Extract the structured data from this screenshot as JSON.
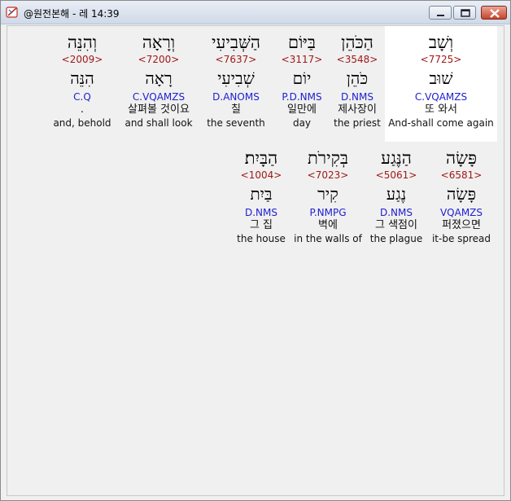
{
  "window": {
    "title": "@원전본해 - 레 14:39",
    "buttons": {
      "minimize": "minimize",
      "maximize": "maximize",
      "close": "close"
    }
  },
  "rows": [
    {
      "words": [
        {
          "hebrew": "וְשָׁב",
          "strong": "<7725>",
          "lemma": "שׁוּב",
          "morph": "C.VQAMZS",
          "korean": "또 와서",
          "english": "And-shall come again",
          "highlighted": true
        },
        {
          "hebrew": "הַכֹּהֵן",
          "strong": "<3548>",
          "lemma": "כֹּהֵן",
          "morph": "D.NMS",
          "korean": "제사장이",
          "english": "the priest"
        },
        {
          "hebrew": "בַּיּוֹם",
          "strong": "<3117>",
          "lemma": "יוֹם",
          "morph": "P.D.NMS",
          "korean": "일만에",
          "english": "day"
        },
        {
          "hebrew": "הַשְּׁבִיעִי",
          "strong": "<7637>",
          "lemma": "שְׁבִיעִי",
          "morph": "D.ANOMS",
          "korean": "칠",
          "english": "the seventh"
        },
        {
          "hebrew": "וְרָאָה",
          "strong": "<7200>",
          "lemma": "רָאָה",
          "morph": "C.VQAMZS",
          "korean": "살펴볼 것이요",
          "english": "and shall look"
        },
        {
          "hebrew": "וְהִנֵּה",
          "strong": "<2009>",
          "lemma": "הִנֵּה",
          "morph": "C.Q",
          "korean": ".",
          "english": "and, behold"
        }
      ]
    },
    {
      "words": [
        {
          "hebrew": "פָּשָׂה",
          "strong": "<6581>",
          "lemma": "פָּשָׂה",
          "morph": "VQAMZS",
          "korean": "퍼졌으면",
          "english": "it-be spread"
        },
        {
          "hebrew": "הַנֶּגַע",
          "strong": "<5061>",
          "lemma": "נֶגַע",
          "morph": "D.NMS",
          "korean": "그 색점이",
          "english": "the plague"
        },
        {
          "hebrew": "בְּקִירֹת",
          "strong": "<7023>",
          "lemma": "קִיר",
          "morph": "P.NMPG",
          "korean": "벽에",
          "english": "in the walls of"
        },
        {
          "hebrew": "הַבָּיִת׃",
          "strong": "<1004>",
          "lemma": "בַּיִת",
          "morph": "D.NMS",
          "korean": "그 집",
          "english": "the house"
        }
      ]
    }
  ]
}
